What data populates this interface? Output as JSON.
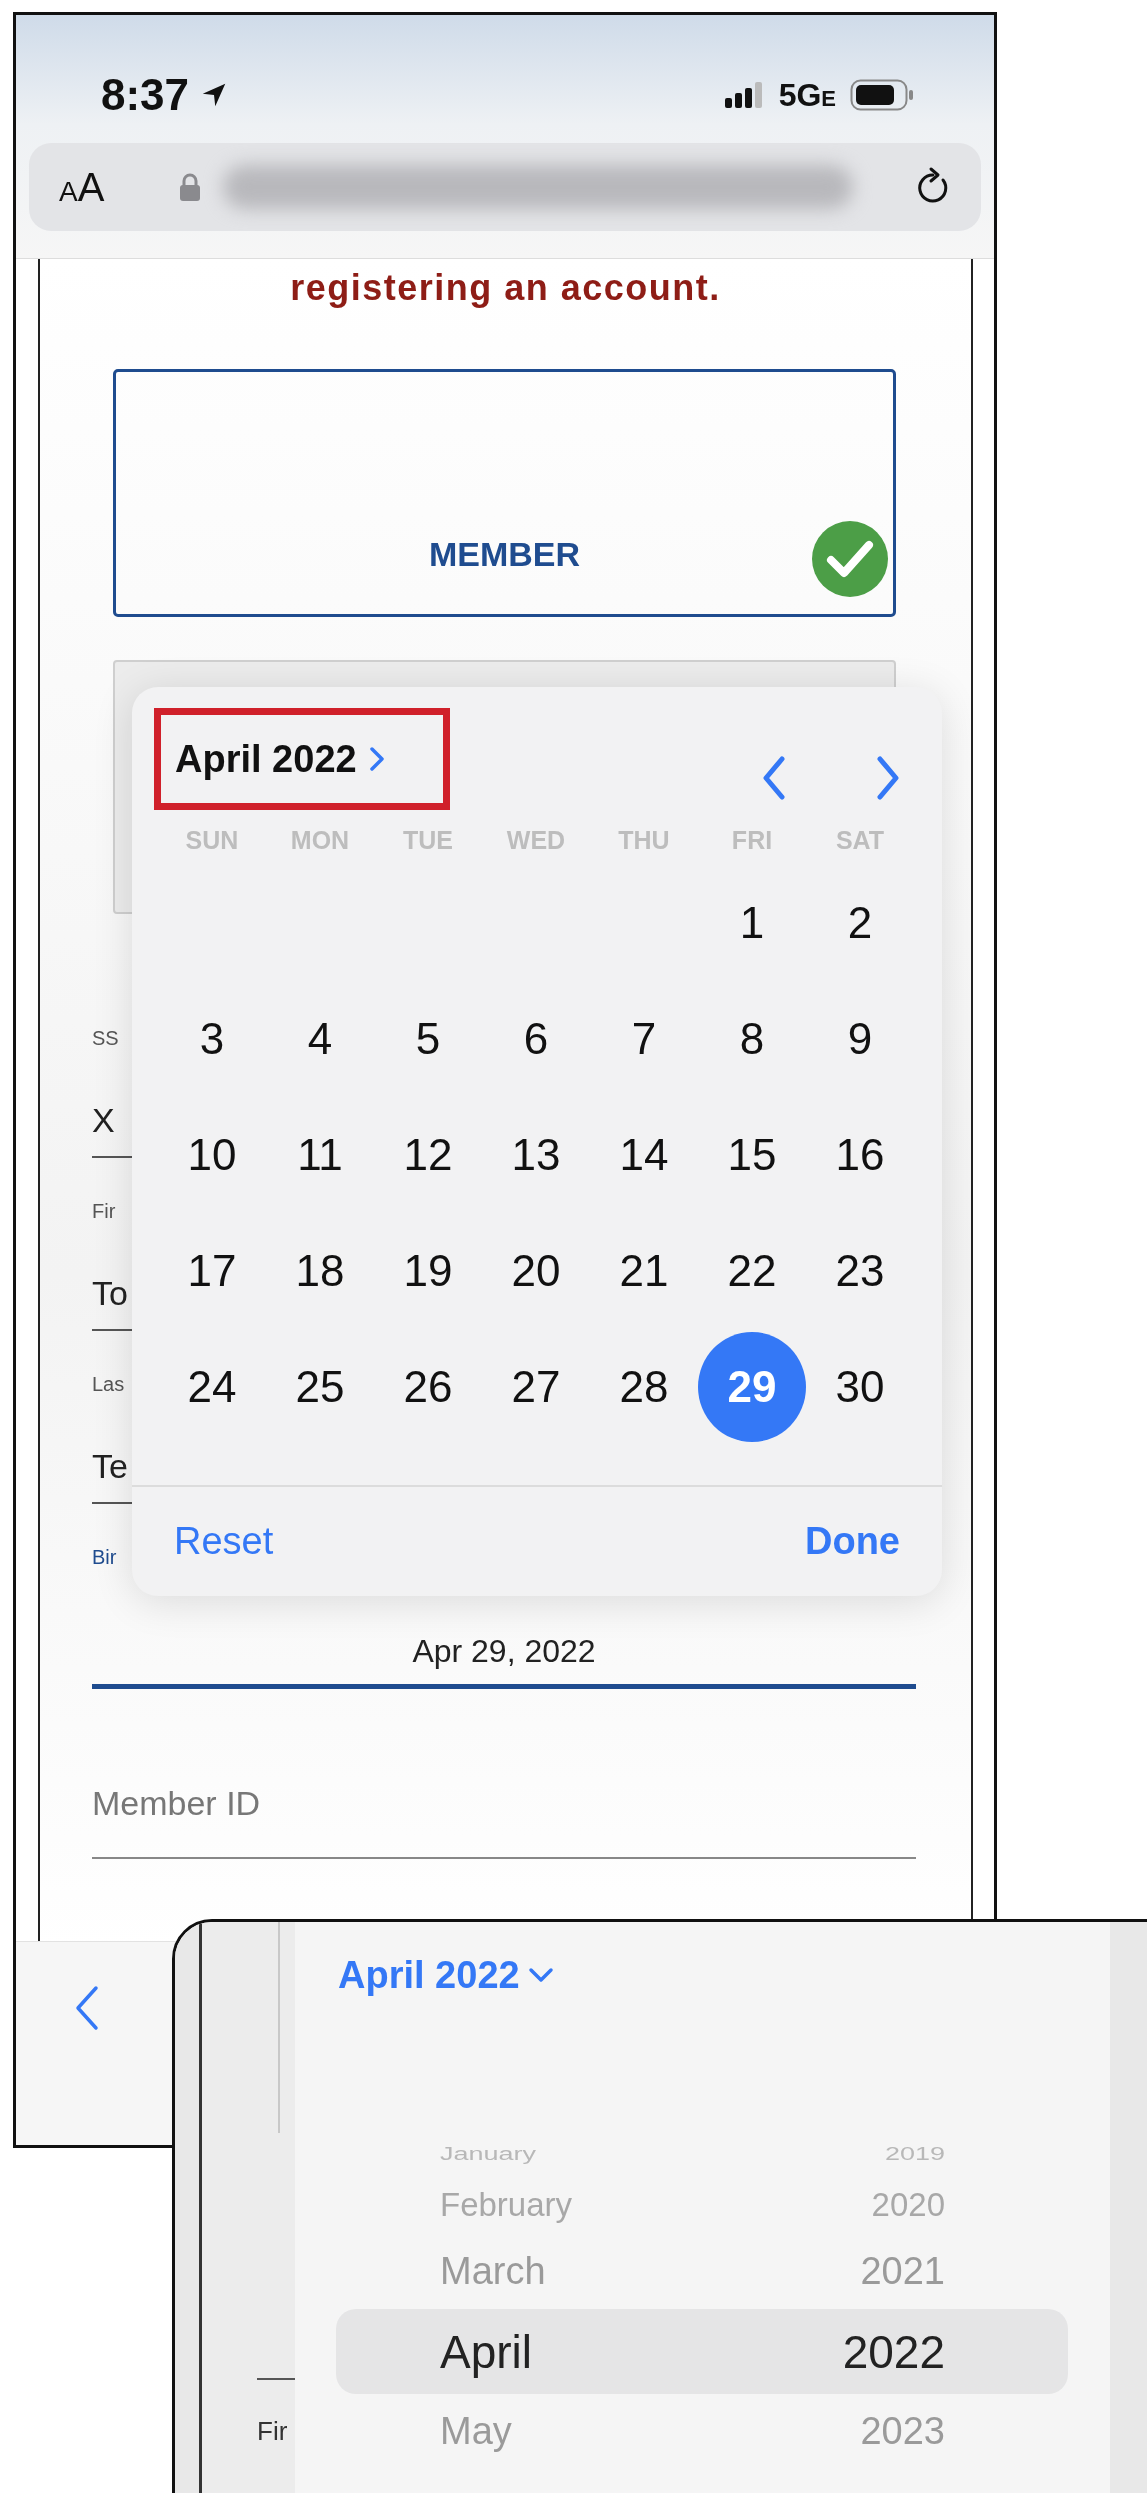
{
  "status_bar": {
    "time": "8:37",
    "network": "5G",
    "network_suffix": "E"
  },
  "address_bar": {
    "reader_label": "AA"
  },
  "page": {
    "notice": "registering an account.",
    "account_options": [
      {
        "label": "MEMBER",
        "selected": true
      }
    ],
    "fields": [
      {
        "kind": "text",
        "label": "SS",
        "value": "X",
        "focused": false
      },
      {
        "kind": "text",
        "label": "Fir",
        "value": "To",
        "focused": false
      },
      {
        "kind": "text",
        "label": "Las",
        "value": "Te",
        "focused": false
      },
      {
        "kind": "date",
        "label": "Bir",
        "value": "Apr 29, 2022",
        "focused": true
      }
    ],
    "member_id": {
      "placeholder": "Member ID"
    }
  },
  "date_popover": {
    "title": "April 2022",
    "weekdays": [
      "SUN",
      "MON",
      "TUE",
      "WED",
      "THU",
      "FRI",
      "SAT"
    ],
    "weeks": [
      [
        {
          "label": "1",
          "selected": false
        },
        {
          "label": "2",
          "selected": false
        }
      ],
      [
        {
          "label": "3",
          "selected": false
        },
        {
          "label": "4",
          "selected": false
        },
        {
          "label": "5",
          "selected": false
        },
        {
          "label": "6",
          "selected": false
        },
        {
          "label": "7",
          "selected": false
        },
        {
          "label": "8",
          "selected": false
        },
        {
          "label": "9",
          "selected": false
        }
      ],
      [
        {
          "label": "10",
          "selected": false
        },
        {
          "label": "11",
          "selected": false
        },
        {
          "label": "12",
          "selected": false
        },
        {
          "label": "13",
          "selected": false
        },
        {
          "label": "14",
          "selected": false
        },
        {
          "label": "15",
          "selected": false
        },
        {
          "label": "16",
          "selected": false
        }
      ],
      [
        {
          "label": "17",
          "selected": false
        },
        {
          "label": "18",
          "selected": false
        },
        {
          "label": "19",
          "selected": false
        },
        {
          "label": "20",
          "selected": false
        },
        {
          "label": "21",
          "selected": false
        },
        {
          "label": "22",
          "selected": false
        },
        {
          "label": "23",
          "selected": false
        }
      ],
      [
        {
          "label": "24",
          "selected": false
        },
        {
          "label": "25",
          "selected": false
        },
        {
          "label": "26",
          "selected": false
        },
        {
          "label": "27",
          "selected": false
        },
        {
          "label": "28",
          "selected": false
        },
        {
          "label": "29",
          "selected": true
        },
        {
          "label": "30",
          "selected": false
        }
      ]
    ],
    "reset": "Reset",
    "done": "Done"
  },
  "overlay": {
    "cut_label": "Fir",
    "picker": {
      "title": "April 2022",
      "months": [
        {
          "label": "January",
          "selected": false
        },
        {
          "label": "February",
          "selected": false
        },
        {
          "label": "March",
          "selected": false
        },
        {
          "label": "April",
          "selected": true
        },
        {
          "label": "May",
          "selected": false
        }
      ],
      "years": [
        {
          "label": "2019",
          "selected": false
        },
        {
          "label": "2020",
          "selected": false
        },
        {
          "label": "2021",
          "selected": false
        },
        {
          "label": "2022",
          "selected": true
        },
        {
          "label": "2023",
          "selected": false
        }
      ]
    }
  }
}
